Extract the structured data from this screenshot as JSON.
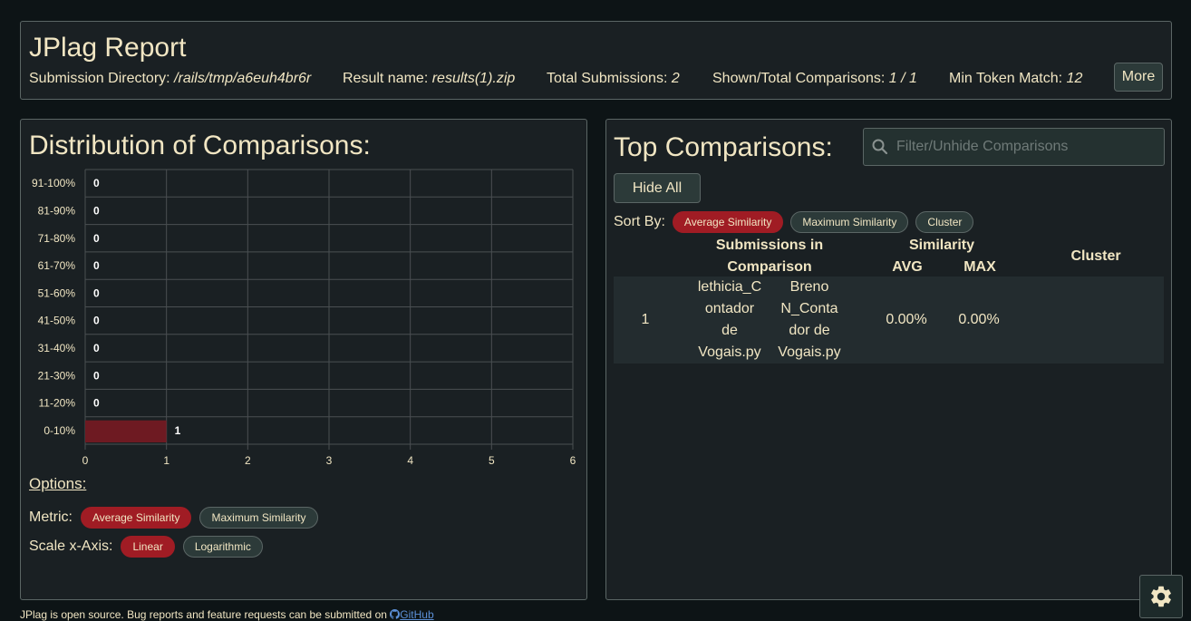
{
  "header": {
    "title": "JPlag Report",
    "submission_dir_label": "Submission Directory:",
    "submission_dir_value": "/rails/tmp/a6euh4br6r",
    "result_name_label": "Result name:",
    "result_name_value": "results(1).zip",
    "total_submissions_label": "Total Submissions:",
    "total_submissions_value": "2",
    "shown_total_label": "Shown/Total Comparisons:",
    "shown_total_value": "1 / 1",
    "min_token_label": "Min Token Match:",
    "min_token_value": "12",
    "more_label": "More"
  },
  "distribution": {
    "title": "Distribution of Comparisons:",
    "options_label": "Options:",
    "metric_label": "Metric:",
    "metric_options": [
      "Average Similarity",
      "Maximum Similarity"
    ],
    "metric_selected": "Average Similarity",
    "scale_label": "Scale x-Axis:",
    "scale_options": [
      "Linear",
      "Logarithmic"
    ],
    "scale_selected": "Linear"
  },
  "chart_data": {
    "type": "bar",
    "orientation": "horizontal",
    "categories": [
      "91-100%",
      "81-90%",
      "71-80%",
      "61-70%",
      "51-60%",
      "41-50%",
      "31-40%",
      "21-30%",
      "11-20%",
      "0-10%"
    ],
    "values": [
      0,
      0,
      0,
      0,
      0,
      0,
      0,
      0,
      0,
      1
    ],
    "xlim": [
      0,
      6
    ],
    "xticks": [
      "0",
      "1",
      "2",
      "3",
      "4",
      "5",
      "6"
    ],
    "grid": true,
    "bar_color": "#6e1a22"
  },
  "top": {
    "title": "Top Comparisons:",
    "filter_placeholder": "Filter/Unhide Comparisons",
    "hide_all_label": "Hide All",
    "sort_by_label": "Sort By:",
    "sort_options": [
      "Average Similarity",
      "Maximum Similarity",
      "Cluster"
    ],
    "sort_selected": "Average Similarity",
    "col_submissions_1": "Submissions in",
    "col_submissions_2": "Comparison",
    "col_similarity": "Similarity",
    "col_avg": "AVG",
    "col_max": "MAX",
    "col_cluster": "Cluster",
    "rows": [
      {
        "index": "1",
        "first": [
          "lethicia_C",
          "ontador",
          "de",
          "Vogais.py"
        ],
        "second": [
          "Breno",
          "N_Conta",
          "dor de",
          "Vogais.py"
        ],
        "avg": "0.00%",
        "max": "0.00%"
      }
    ]
  },
  "footer": {
    "text": "JPlag is open source. Bug reports and feature requests can be submitted on",
    "link": "GitHub"
  },
  "colors": {
    "accent": "#a01c24",
    "background": "#0d1416",
    "panel": "#1a2023",
    "text": "#f1e6c3"
  },
  "icons": {
    "search": "search-icon",
    "settings": "gear-icon",
    "github": "github-icon"
  }
}
